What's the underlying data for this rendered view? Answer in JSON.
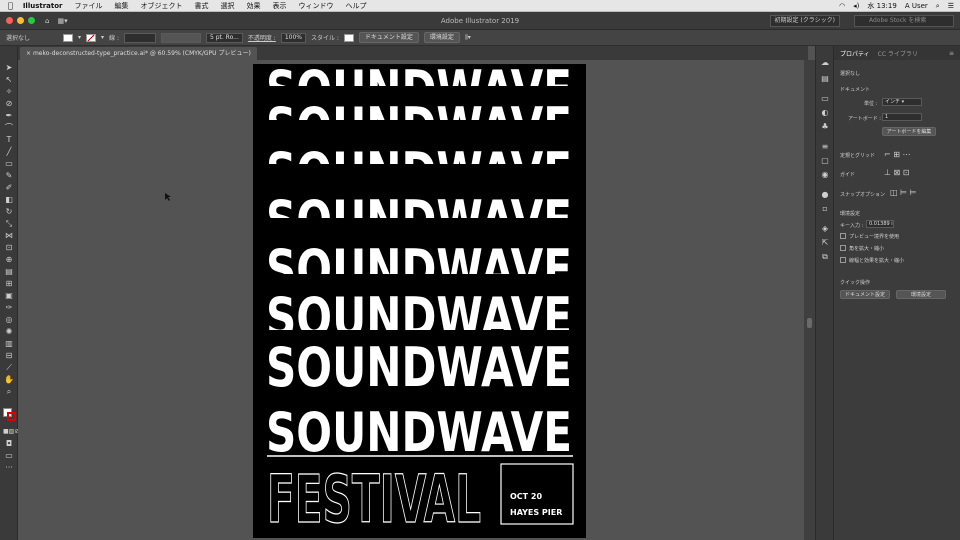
{
  "menubar": {
    "app_name": "Illustrator",
    "items": [
      "ファイル",
      "編集",
      "オブジェクト",
      "書式",
      "選択",
      "効果",
      "表示",
      "ウィンドウ",
      "ヘルプ"
    ],
    "clock": "水 13:19",
    "user": "A User"
  },
  "appbar": {
    "title": "Adobe Illustrator 2019",
    "workspace": "初期設定 (クラシック)",
    "stock_placeholder": "Adobe Stock を検索"
  },
  "controlbar": {
    "selection": "選択なし",
    "stroke_label": "線 :",
    "brush": "5 pt. Ro...",
    "opacity_label": "不透明度 :",
    "opacity_value": "100%",
    "style_label": "スタイル :",
    "doc_setup_button": "ドキュメント設定",
    "prefs_button": "環境設定"
  },
  "tab": {
    "label": "meko-deconstructed-type_practice.ai* @ 60.59% (CMYK/GPU プレビュー)"
  },
  "poster": {
    "word": "SOUNDWAVE",
    "festival": "FESTIVAL",
    "date": "OCT 20",
    "place": "HAYES PIER"
  },
  "panel": {
    "tab_properties": "プロパティ",
    "tab_libraries": "CC ライブラリ",
    "no_selection": "選択なし",
    "document_heading": "ドキュメント",
    "units_label": "単位 :",
    "units_value": "インチ",
    "artboard_label": "アートボード :",
    "artboard_value": "1",
    "edit_artboards_button": "アートボードを編集",
    "rulers_grids_label": "定規とグリッド",
    "guides_label": "ガイド",
    "snap_label": "スナップオプション",
    "prefs_heading": "環境設定",
    "key_input_label": "キー入力 :",
    "key_input_value": "0.01389 i",
    "check_preview_bounds": "プレビュー境界を使用",
    "check_scale_corners": "角を拡大・縮小",
    "check_scale_strokes": "線幅と効果を拡大・縮小",
    "quick_actions_heading": "クイック操作",
    "quick_doc_setup": "ドキュメント設定",
    "quick_prefs": "環境設定"
  }
}
